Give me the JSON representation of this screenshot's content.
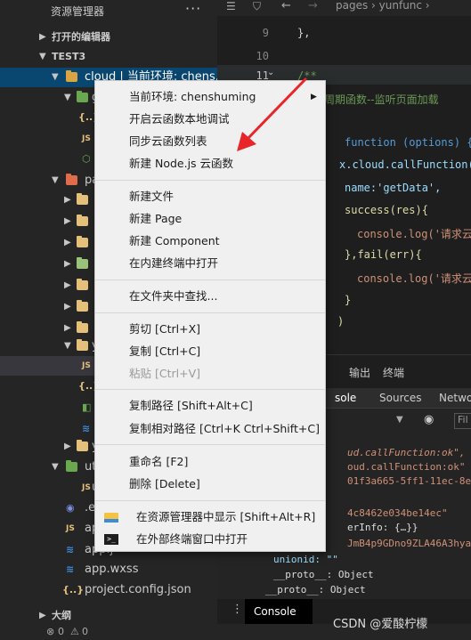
{
  "sidebar": {
    "title": "资源管理器",
    "more": "···",
    "open_editors": "打开的编辑器",
    "project": "TEST3",
    "cloud_folder": "cloud | 当前环境: chens...",
    "items": [
      ".e",
      "ap",
      "app.j",
      "app.wxss",
      "project.config.json"
    ],
    "partial_letters": [
      "g",
      "pa",
      "a",
      "e",
      "i",
      "l",
      "s",
      "s",
      "s",
      "y",
      "y",
      "ut",
      "u"
    ],
    "outline": "大纲"
  },
  "editor": {
    "breadcrumb": "pages › yunfunc ›",
    "lines": [
      "9",
      "10",
      "11"
    ],
    "code": [
      "},",
      "/**",
      "周期函数--监听页面加载",
      "function (options) {",
      "x.cloud.callFunction({",
      "name:'getData',",
      "success(res){",
      "console.log('请求云",
      "},fail(err){",
      "console.log('请求云",
      "}",
      ")"
    ]
  },
  "panel": {
    "tabs": [
      "输出",
      "终端"
    ],
    "devtools_tabs": [
      "sole",
      "Sources",
      "Netwo"
    ],
    "filter": "Fil",
    "console_lines": [
      "ud.callFunction:ok\", re",
      "oud.callFunction:ok\"",
      "01f3a665-5ff1-11ec-8e7",
      "4c8462e034be14ec\"",
      "erInfo: {…}}",
      "JmB4p9GDno9ZLA46A3hya",
      "unionid: \"\"",
      "__proto__: Object",
      "__proto__: Object"
    ],
    "console_tab": "Console"
  },
  "status": {
    "errors": "0",
    "warnings": "0",
    "watermark": "CSDN @爱酸柠檬"
  },
  "menu": {
    "items": [
      {
        "label": "当前环境: chenshuming",
        "submenu": true
      },
      {
        "label": "开启云函数本地调试"
      },
      {
        "label": "同步云函数列表"
      },
      {
        "label": "新建 Node.js 云函数"
      },
      {
        "label": "新建文件"
      },
      {
        "label": "新建 Page"
      },
      {
        "label": "新建 Component"
      },
      {
        "label": "在内建终端中打开"
      },
      {
        "label": "在文件夹中查找..."
      },
      {
        "label": "剪切  [Ctrl+X]"
      },
      {
        "label": "复制  [Ctrl+C]"
      },
      {
        "label": "粘贴  [Ctrl+V]",
        "disabled": true
      },
      {
        "label": "复制路径  [Shift+Alt+C]"
      },
      {
        "label": "复制相对路径  [Ctrl+K Ctrl+Shift+C]"
      },
      {
        "label": "重命名  [F2]"
      },
      {
        "label": "删除  [Delete]"
      },
      {
        "label": "在资源管理器中显示  [Shift+Alt+R]"
      },
      {
        "label": "在外部终端窗口中打开"
      }
    ]
  },
  "colors": {
    "accent_selection": "#094771",
    "arrow": "#e8262a",
    "keyword": "#569cd6",
    "string": "#ce9178",
    "comment": "#6a9955"
  }
}
